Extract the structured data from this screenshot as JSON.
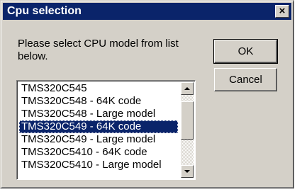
{
  "window": {
    "title": "Cpu selection",
    "close_glyph": "×"
  },
  "prompt": "Please select CPU model from list below.",
  "buttons": {
    "ok": "OK",
    "cancel": "Cancel"
  },
  "list": {
    "items": [
      "TMS320C545",
      "TMS320C548 - 64K code",
      "TMS320C548 - Large model",
      "TMS320C549 - 64K code",
      "TMS320C549 - Large model",
      "TMS320C5410 - 64K code",
      "TMS320C5410 - Large model"
    ],
    "selected_index": 3
  },
  "icons": {
    "close": "close-icon",
    "scroll_up": "scroll-up-arrow-icon",
    "scroll_down": "scroll-down-arrow-icon"
  },
  "colors": {
    "titlebar": "#0a246a",
    "face": "#d4d0c8",
    "selection": "#0a246a"
  }
}
